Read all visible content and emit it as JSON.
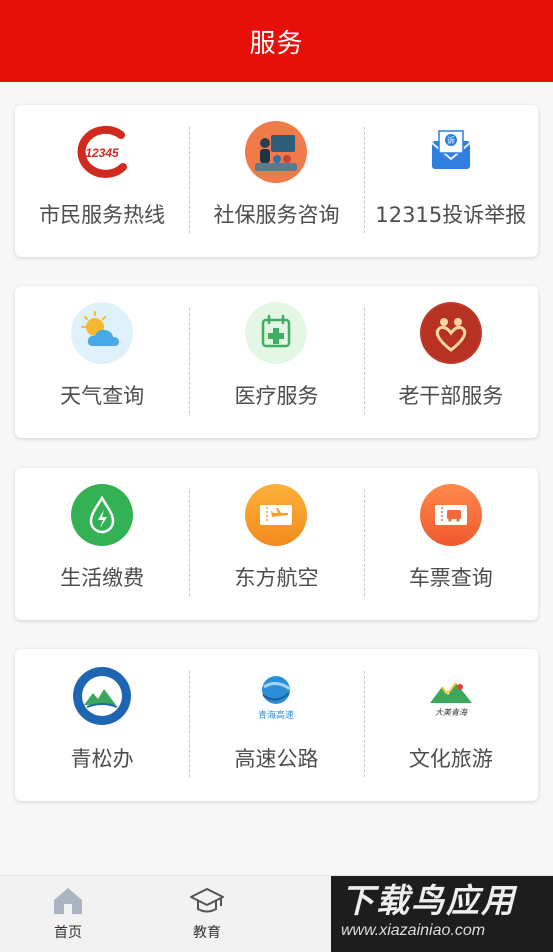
{
  "header": {
    "title": "服务"
  },
  "colors": {
    "brand_red": "#e60f0a",
    "label_gray": "#4d4d4d"
  },
  "groups": [
    {
      "items": [
        {
          "icon": "hotline-12345-icon",
          "label": "市民服务热线",
          "icon_text": "12345"
        },
        {
          "icon": "social-security-consult-icon",
          "label": "社保服务咨询"
        },
        {
          "icon": "complaint-envelope-icon",
          "label": "12315投诉举报",
          "icon_text": "诉"
        }
      ]
    },
    {
      "items": [
        {
          "icon": "weather-sun-cloud-icon",
          "label": "天气查询"
        },
        {
          "icon": "medical-calendar-cross-icon",
          "label": "医疗服务"
        },
        {
          "icon": "elder-hearts-icon",
          "label": "老干部服务"
        }
      ]
    },
    {
      "items": [
        {
          "icon": "water-drop-bolt-icon",
          "label": "生活缴费"
        },
        {
          "icon": "airplane-ticket-icon",
          "label": "东方航空"
        },
        {
          "icon": "bus-ticket-icon",
          "label": "车票查询"
        }
      ]
    },
    {
      "items": [
        {
          "icon": "qingsong-emblem-icon",
          "label": "青松办"
        },
        {
          "icon": "highway-globe-logo-icon",
          "label": "高速公路",
          "icon_text": "青海高速"
        },
        {
          "icon": "mountain-tourism-logo-icon",
          "label": "文化旅游",
          "icon_text": "大美青海"
        }
      ]
    }
  ],
  "tabbar": {
    "tabs": [
      {
        "icon": "home-icon",
        "label": "首页"
      },
      {
        "icon": "graduation-cap-icon",
        "label": "教育"
      }
    ]
  },
  "watermark": {
    "title": "下载鸟应用",
    "url": "www.xiazainiao.com"
  }
}
